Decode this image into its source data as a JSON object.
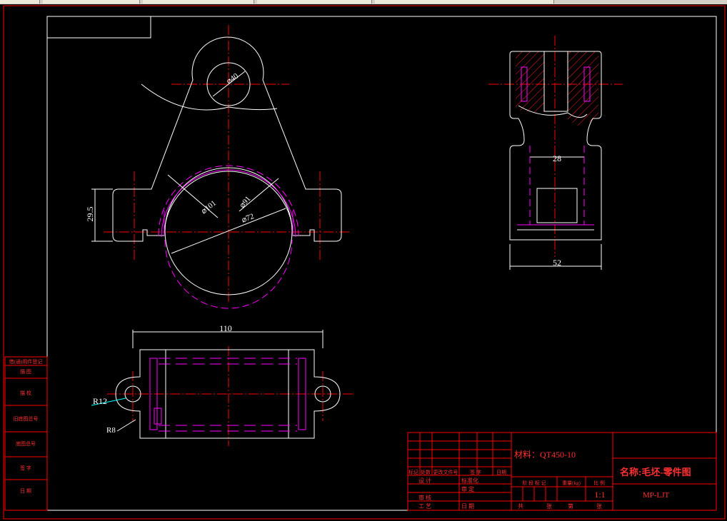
{
  "window": {
    "toolbar_segments": 5
  },
  "colors": {
    "background": "#000000",
    "frame": "#ff0000",
    "outline": "#ffffff",
    "center_line": "#ff0000",
    "hidden_line": "#ff00ff",
    "hatch": "#ff2020",
    "dimension": "#ffffff",
    "leader_r12": "#00ffff"
  },
  "dimensions": {
    "top_hole": "⌀40",
    "bore_101": "⌀101",
    "bore_91": "⌀91",
    "bore_72": "⌀72",
    "height_29_5": "29.5",
    "side_width_28": "28",
    "side_width_52": "52",
    "length_110": "110",
    "radius_12": "R12",
    "radius_8": "R8"
  },
  "left_table": {
    "rows": [
      "借(通)用件登记",
      "描  图",
      "描  校",
      "旧底图总号",
      "底图总号",
      "签  字",
      "日  期"
    ]
  },
  "title_block": {
    "material_label": "材料：QT450-10",
    "name_label": "名称:毛坯-零件图",
    "drawing_number": "MP-LJT",
    "scale": "1:1",
    "header_row": [
      "标记",
      "处数",
      "更改文件号",
      "签  字",
      "日期"
    ],
    "row_design": [
      "设  计",
      "标准化"
    ],
    "row_review": [
      "审  核",
      "审  定"
    ],
    "row_process": [
      "工  艺",
      "日  期"
    ],
    "stage_labels": [
      "阶 段 标 记",
      "重量(kg)",
      "比  例"
    ],
    "sheet_labels": [
      "共",
      "张",
      "第",
      "张"
    ]
  }
}
